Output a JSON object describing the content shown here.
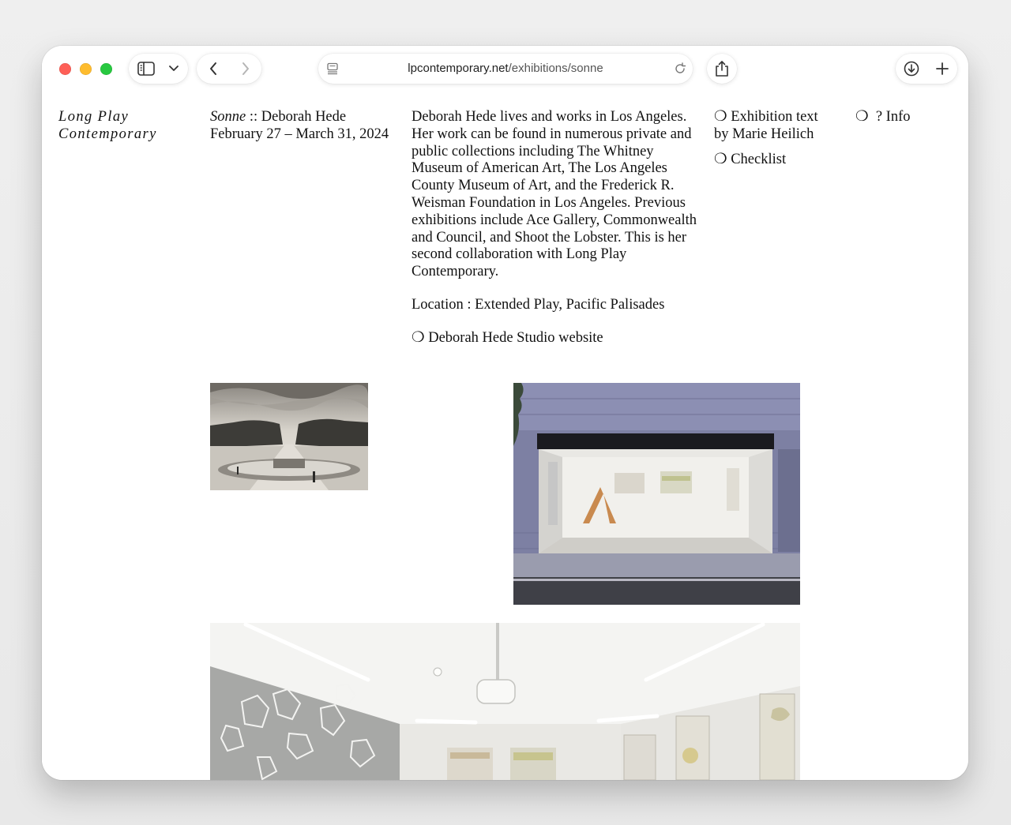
{
  "browser": {
    "url_domain": "lpcontemporary.net",
    "url_path": "/exhibitions/sonne"
  },
  "site": {
    "logo_line1": "Long Play",
    "logo_line2": "Contemporary"
  },
  "exhibition": {
    "title_italic": "Sonne",
    "title_rest": " :: Deborah Hede",
    "dates": "February 27 – March 31, 2024",
    "bio": "Deborah Hede lives and works in Los Angeles. Her work can be found in numerous private and public collections including The Whitney Museum of American Art, The Los Angeles County Museum of Art, and the Frederick R. Weisman Foundation in Los Angeles. Previous exhibitions include Ace Gallery, Commonwealth and Council, and Shoot the Lobster. This is her second collaboration with Long Play Contemporary.",
    "location": "Location : Extended Play, Pacific Palisades",
    "website_link": "❍ Deborah Hede Studio website"
  },
  "links": {
    "exhibition_text": "❍ Exhibition text by Marie Heilich",
    "checklist": "❍ Checklist",
    "info": "❍  ? Info"
  }
}
